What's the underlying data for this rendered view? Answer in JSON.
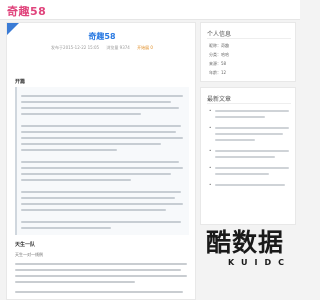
{
  "site": {
    "logo": "奇趣58"
  },
  "article": {
    "title": "奇趣58",
    "meta": {
      "date": "发布于2015-12-22 15:05",
      "views": "浏览量 9374",
      "label": "开始展 0"
    },
    "section_open": "开篇",
    "section_two": "天生一队",
    "section_two_sub": "天生一对一线例"
  },
  "sidebar": {
    "info_title": "个人信息",
    "info": [
      "昵称：奇趣",
      "分类：哈哈",
      "来源：58",
      "年龄：12"
    ],
    "recent_title": "最新文章"
  },
  "watermark": {
    "main": "酷数据",
    "sub": "KUIDC"
  }
}
